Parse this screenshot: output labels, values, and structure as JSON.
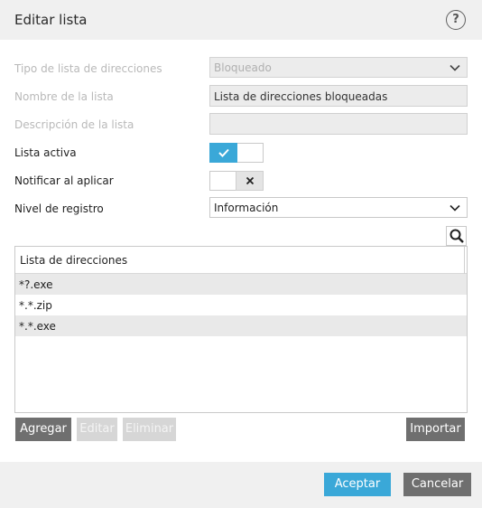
{
  "dialog": {
    "title": "Editar lista",
    "help_symbol": "?"
  },
  "form": {
    "type_label": "Tipo de lista de direcciones",
    "type_value": "Bloqueado",
    "name_label": "Nombre de la lista",
    "name_value": "Lista de direcciones bloqueadas",
    "desc_label": "Descripción de la lista",
    "desc_value": "",
    "active_label": "Lista activa",
    "active_on": true,
    "notify_label": "Notificar al aplicar",
    "notify_on": false,
    "log_label": "Nivel de registro",
    "log_value": "Información"
  },
  "list": {
    "header": "Lista de direcciones",
    "rows": [
      "*?.exe",
      "*.*.zip",
      "*.*.exe"
    ]
  },
  "buttons": {
    "add": "Agregar",
    "edit": "Editar",
    "delete": "Eliminar",
    "import": "Importar",
    "accept": "Aceptar",
    "cancel": "Cancelar"
  },
  "colors": {
    "accent": "#3aa8d8",
    "button_grey": "#6f6f6f",
    "button_disabled": "#d6d6d6"
  },
  "icons": {
    "help": "question-circle-icon",
    "chevron": "chevron-down-icon",
    "check": "check-icon",
    "close": "x-icon",
    "search": "magnifier-icon"
  }
}
